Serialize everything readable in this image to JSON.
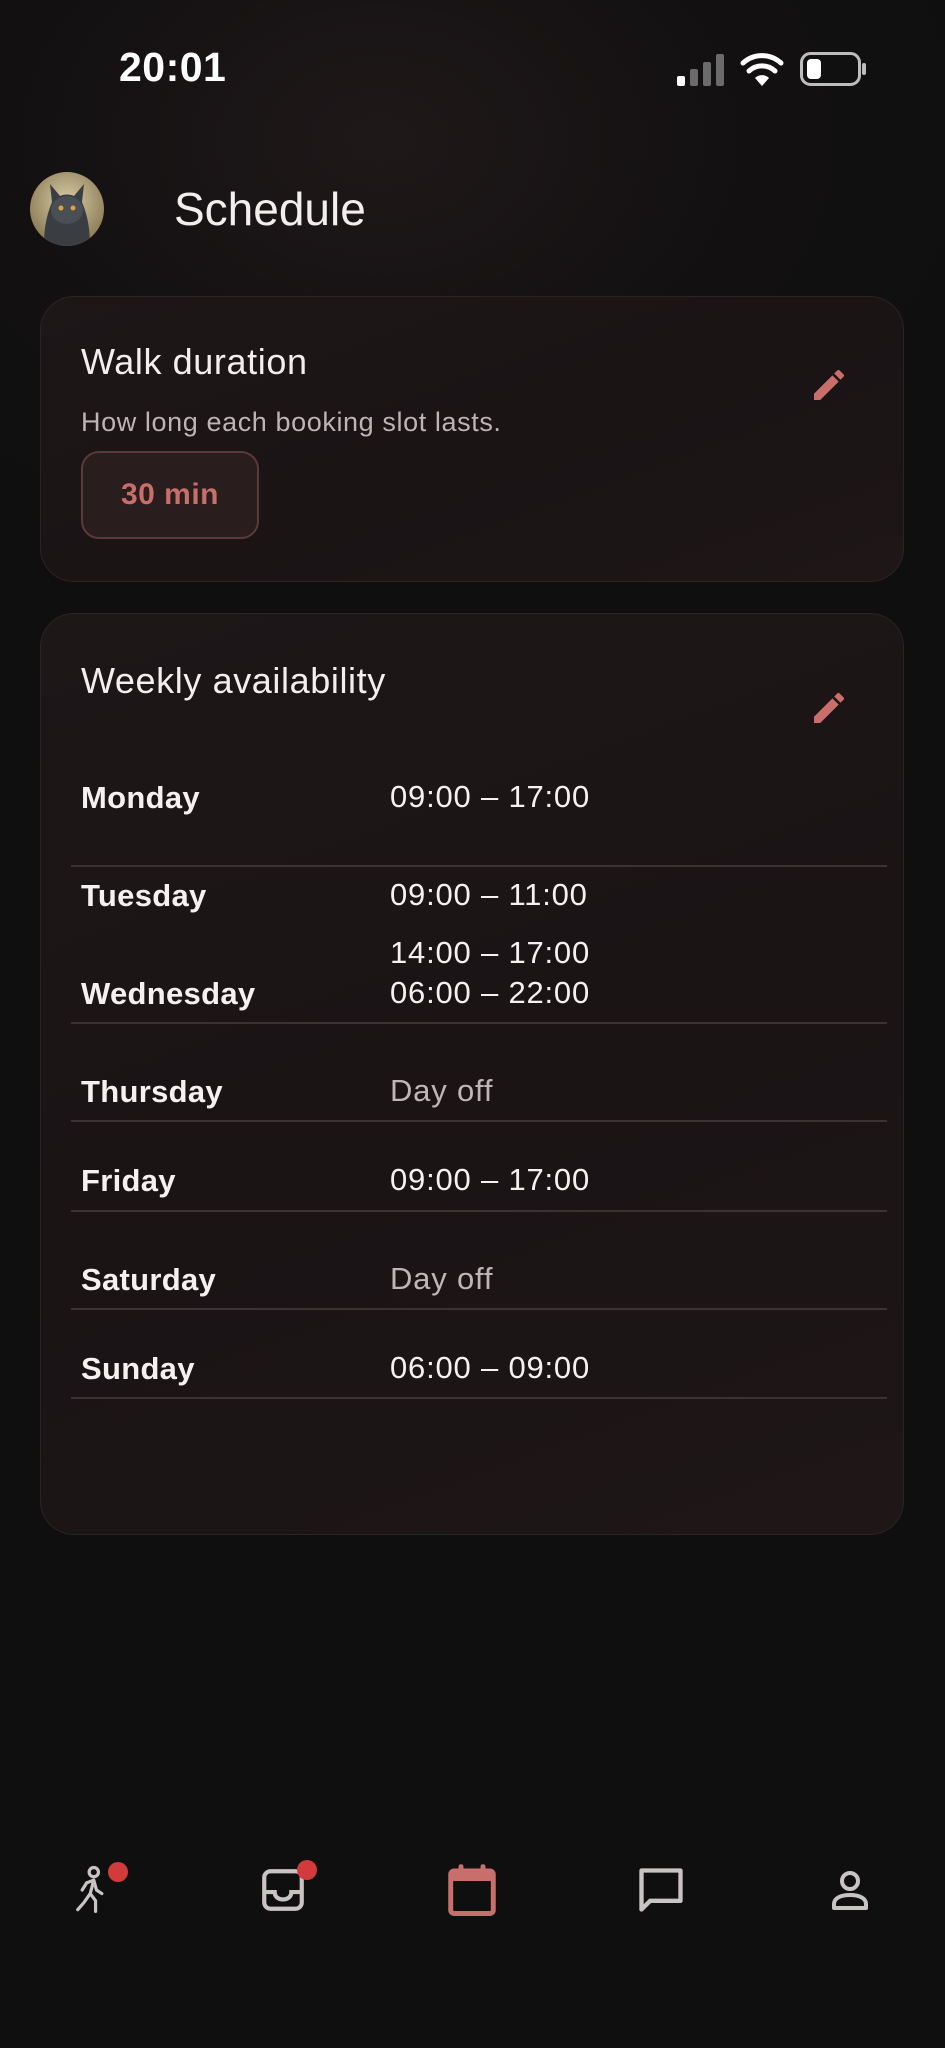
{
  "status_bar": {
    "time": "20:01"
  },
  "header": {
    "title": "Schedule"
  },
  "duration_card": {
    "title": "Walk duration",
    "subtitle": "How long each booking slot lasts.",
    "value": "30 min"
  },
  "availability_card": {
    "title": "Weekly availability",
    "days": [
      {
        "day": "Monday",
        "hours": [
          "09:00 – 17:00"
        ]
      },
      {
        "day": "Tuesday",
        "hours": [
          "09:00 – 11:00",
          "14:00 – 17:00"
        ]
      },
      {
        "day": "Wednesday",
        "hours": [
          "06:00 – 22:00"
        ]
      },
      {
        "day": "Thursday",
        "hours": [
          "Day off"
        ]
      },
      {
        "day": "Friday",
        "hours": [
          "09:00 – 17:00"
        ]
      },
      {
        "day": "Saturday",
        "hours": [
          "Day off"
        ]
      },
      {
        "day": "Sunday",
        "hours": [
          "06:00 – 09:00"
        ]
      }
    ]
  },
  "bottom_nav": {
    "items": [
      {
        "icon": "walk-icon",
        "badge": true,
        "active": false
      },
      {
        "icon": "inbox-icon",
        "badge": true,
        "active": false
      },
      {
        "icon": "calendar-icon",
        "badge": false,
        "active": true
      },
      {
        "icon": "chat-icon",
        "badge": false,
        "active": false
      },
      {
        "icon": "profile-icon",
        "badge": false,
        "active": false
      }
    ]
  },
  "colors": {
    "accent": "#c86f6c",
    "badge": "#d23b3b",
    "background": "#121011"
  }
}
